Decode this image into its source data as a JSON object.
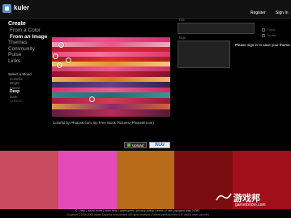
{
  "header": {
    "logo_text": "kuler",
    "links": {
      "register": "Register",
      "sign_in": "Sign In"
    }
  },
  "nav": {
    "create": "Create",
    "from_a_color": "From a Color",
    "from_an_image": "From an Image",
    "themes": "Themes",
    "community": "Community",
    "pulse": "Pulse",
    "links": "Links"
  },
  "mood": {
    "title": "Select a Mood",
    "options": [
      "Colorful",
      "Bright",
      "Muted",
      "Deep",
      "Dark",
      "Custom"
    ],
    "selected": "Deep"
  },
  "image": {
    "caption": "Colorful by Photos8.com, By Free Stock Pictures (Photos8.com)",
    "upload_label": "Upload",
    "flickr_label": "flickr"
  },
  "form": {
    "title_label": "Title",
    "tags_label": "Tags",
    "public_label": "Public",
    "private_label": "Private",
    "notice": "Please sign in to save your theme."
  },
  "swatches": [
    "#c84b5e",
    "#e54ab9",
    "#b76a17",
    "#7a0d10",
    "#a0101a"
  ],
  "footer": {
    "links": "© | help | about kuler | kuler beta | developers | privacy policy | terms of use (updated May 2008)",
    "copyright": "Copyright © 2006-2008 Adobe Systems Incorporated | All rights reserved | Patents pending in the U.S. and/or other countries"
  },
  "watermark": {
    "text": "游戏邦",
    "url": "gamerboom.com"
  }
}
